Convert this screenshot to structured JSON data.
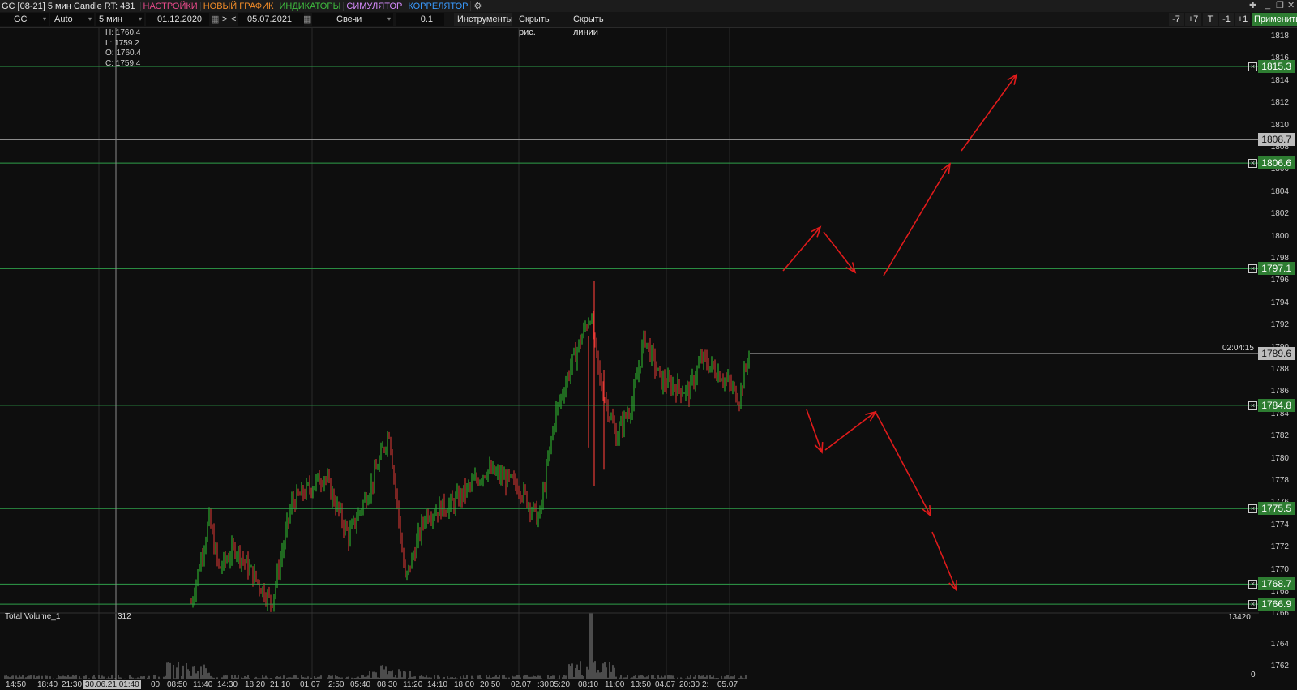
{
  "titlebar": {
    "title": "GC [08-21] 5 мин Candle RT: 481",
    "menu": [
      {
        "label": "НАСТРОЙКИ",
        "color": "#e84a8a"
      },
      {
        "label": "НОВЫЙ ГРАФИК",
        "color": "#f28c28"
      },
      {
        "label": "ИНДИКАТОРЫ",
        "color": "#3fbf3f"
      },
      {
        "label": "СИМУЛЯТОР",
        "color": "#d88cff"
      },
      {
        "label": "КОРРЕЛЯТОР",
        "color": "#3a9bff"
      }
    ],
    "settings_icon": "gears-icon",
    "window_controls": [
      "pin-icon",
      "minimize-icon",
      "restore-icon",
      "close-icon"
    ]
  },
  "toolbar": {
    "symbol": "GC",
    "scale": "Auto",
    "timeframe": "5 мин",
    "date_from": "01.12.2020",
    "date_to": "05.07.2021",
    "nav_next": ">",
    "nav_prev": "<",
    "chart_type": "Свечи",
    "step": "0.1",
    "instruments": "Инструменты",
    "hide_drawings": "Скрыть рис.",
    "hide_lines": "Скрыть линии",
    "btn_minus7": "-7",
    "btn_plus7": "+7",
    "btn_t": "T",
    "btn_minus1": "-1",
    "btn_plus1": "+1",
    "apply": "Применить"
  },
  "ohlc": {
    "high": "H: 1760.4",
    "low": "L: 1759.2",
    "open": "O: 1760.4",
    "close": "C: 1759.4"
  },
  "price_axis": {
    "ticks": [
      "1818",
      "1816",
      "1814",
      "1812",
      "1810",
      "1808",
      "1806",
      "1804",
      "1802",
      "1800",
      "1798",
      "1796",
      "1794",
      "1792",
      "1790",
      "1788",
      "1786",
      "1784",
      "1782",
      "1780",
      "1778",
      "1776",
      "1774",
      "1772",
      "1770",
      "1768",
      "1766",
      "1764",
      "1762"
    ]
  },
  "levels": [
    {
      "price": "1815.3",
      "kind": "green"
    },
    {
      "price": "1808.7",
      "kind": "gray"
    },
    {
      "price": "1806.6",
      "kind": "green"
    },
    {
      "price": "1797.1",
      "kind": "green"
    },
    {
      "price": "1784.8",
      "kind": "green"
    },
    {
      "price": "1775.5",
      "kind": "green"
    },
    {
      "price": "1768.7",
      "kind": "green"
    },
    {
      "price": "1766.9",
      "kind": "green"
    }
  ],
  "current": {
    "price": "1789.6",
    "timer": "02:04:15"
  },
  "volume": {
    "title": "Total Volume_1",
    "cursor_value": "312",
    "max": "13420",
    "zero": "0"
  },
  "time_axis": [
    "14:50",
    "18:40",
    "21:30",
    "30.06.21 01:40",
    "00",
    "08:50",
    "11:40",
    "14:30",
    "18:20",
    "21:10",
    "01.07",
    "2:50",
    "05:40",
    "08:30",
    "11:20",
    "14:10",
    "18:00",
    "20:50",
    "02.07",
    ":30",
    "05:20",
    "08:10",
    "11:00",
    "13:50",
    "04.07",
    "20:30",
    "2:",
    "05.07"
  ],
  "colors": {
    "up": "#33c633",
    "down": "#e53935",
    "level": "#2e9e4a",
    "arrow": "#e01b1b",
    "grid": "#2b2b2b"
  }
}
